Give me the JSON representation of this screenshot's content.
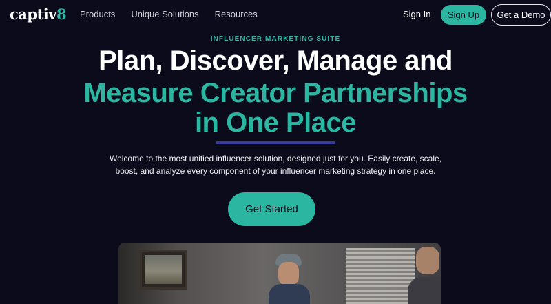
{
  "nav": {
    "logo": {
      "text": "captiv",
      "accent": "8"
    },
    "links": [
      "Products",
      "Unique Solutions",
      "Resources"
    ],
    "sign_in": "Sign In",
    "sign_up": "Sign Up",
    "get_demo": "Get a Demo"
  },
  "hero": {
    "eyebrow": "INFLUENCER MARKETING SUITE",
    "headline_line1": "Plan, Discover, Manage and",
    "headline_line2": "Measure Creator Partnerships",
    "headline_line3": "in One Place",
    "description_line1": "Welcome to the most unified influencer solution, designed just for you. Easily create, scale,",
    "description_line2": "boost, and analyze every component of your influencer marketing strategy in one place.",
    "cta": "Get Started"
  },
  "colors": {
    "background": "#0b0b1c",
    "accent": "#2bb6a2",
    "underline": "#3b3aa0"
  }
}
